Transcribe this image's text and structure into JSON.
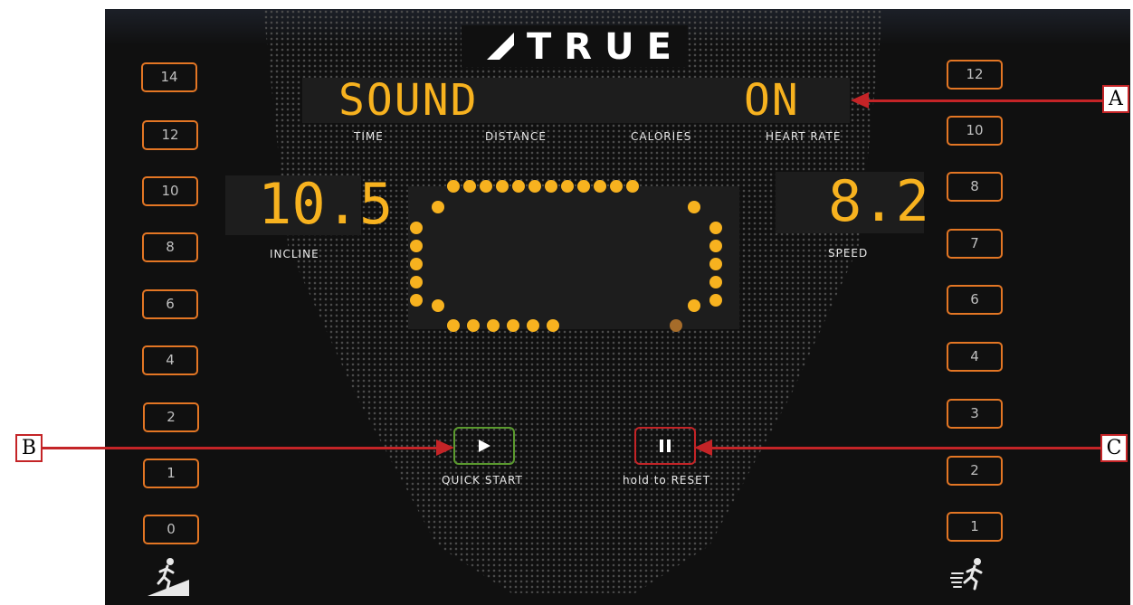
{
  "brand": {
    "name": "TRUE"
  },
  "message": {
    "left": "SOUND",
    "right": "ON"
  },
  "metrics": [
    "TIME",
    "DISTANCE",
    "CALORIES",
    "HEART RATE"
  ],
  "incline": {
    "value": "10.5",
    "label": "INCLINE"
  },
  "speed": {
    "value": "8.2",
    "label": "SPEED"
  },
  "incline_presets": [
    "14",
    "12",
    "10",
    "8",
    "6",
    "4",
    "2",
    "1",
    "0"
  ],
  "speed_presets": [
    "12",
    "10",
    "8",
    "7",
    "6",
    "4",
    "3",
    "2",
    "1"
  ],
  "controls": {
    "start_label": "QUICK START",
    "stop_label": "hold to RESET"
  },
  "callouts": {
    "a": "A",
    "b": "B",
    "c": "C"
  },
  "colors": {
    "led": "#f7b21f",
    "preset_border": "#e37624",
    "start_border": "#5a9a2e",
    "stop_border": "#c42427",
    "callout": "#c42427"
  },
  "icons": [
    "incline-runner-icon",
    "speed-runner-icon",
    "play-icon",
    "pause-icon",
    "true-logo-icon"
  ]
}
